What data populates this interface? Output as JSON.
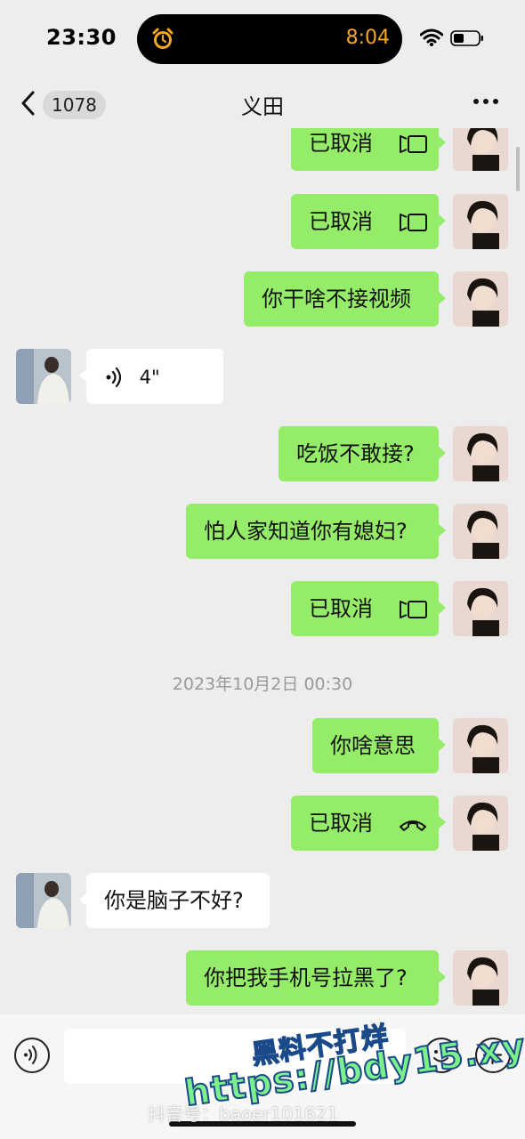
{
  "status_bar": {
    "time": "23:30",
    "island_time": "8:04"
  },
  "nav": {
    "back_count": "1078",
    "title": "义田"
  },
  "messages": [
    {
      "from": "me",
      "text": "已取消",
      "kind": "video-call-cancelled"
    },
    {
      "from": "me",
      "text": "已取消",
      "kind": "video-call-cancelled"
    },
    {
      "from": "me",
      "text": "你干啥不接视频"
    },
    {
      "from": "them",
      "text": "4\"",
      "kind": "voice"
    },
    {
      "from": "me",
      "text": "吃饭不敢接?"
    },
    {
      "from": "me",
      "text": "怕人家知道你有媳妇?"
    },
    {
      "from": "me",
      "text": "已取消",
      "kind": "video-call-cancelled"
    },
    {
      "from": "me",
      "text": "你啥意思"
    },
    {
      "from": "me",
      "text": "已取消",
      "kind": "voice-call-cancelled"
    },
    {
      "from": "them",
      "text": "你是脑子不好?"
    },
    {
      "from": "me",
      "text": "你把我手机号拉黑了?"
    }
  ],
  "timestamp": "2023年10月2日 00:30",
  "watermark": {
    "line1": "黑料不打烊",
    "line2": "https://bdy15.xyz",
    "line3": "抖音号：baoer101621"
  },
  "colors": {
    "my_bubble": "#95ec69",
    "their_bubble": "#ffffff",
    "background": "#ededed",
    "island_accent": "#f5a623"
  },
  "icons": [
    "alarm-icon",
    "wifi-icon",
    "battery-icon",
    "chevron-left-icon",
    "more-icon",
    "video-call-icon",
    "phone-hangup-icon",
    "voice-wave-icon",
    "emoji-icon",
    "plus-icon"
  ]
}
